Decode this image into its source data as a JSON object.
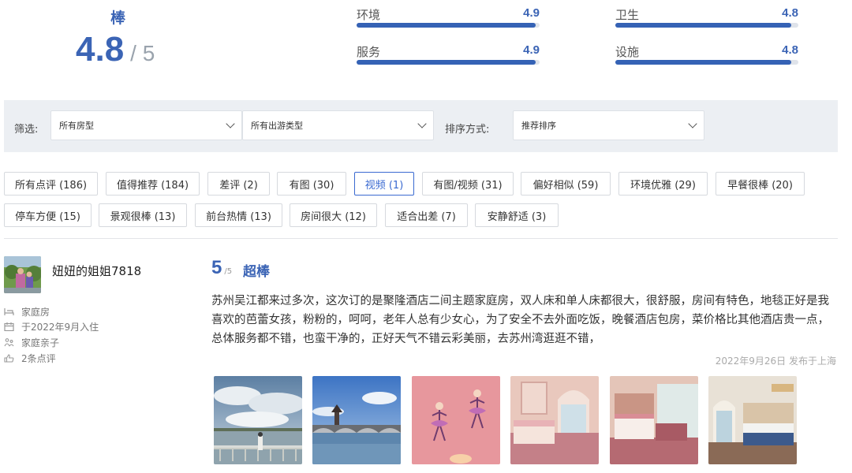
{
  "overall": {
    "word": "棒",
    "score": "4.8",
    "out_of": "/ 5"
  },
  "metrics": [
    {
      "label": "环境",
      "value": "4.9",
      "fraction": 0.98
    },
    {
      "label": "卫生",
      "value": "4.8",
      "fraction": 0.96
    },
    {
      "label": "服务",
      "value": "4.9",
      "fraction": 0.98
    },
    {
      "label": "设施",
      "value": "4.8",
      "fraction": 0.96
    }
  ],
  "filter": {
    "label": "筛选:",
    "room_type": "所有房型",
    "travel_type": "所有出游类型",
    "sort_label": "排序方式:",
    "sort_value": "推荐排序"
  },
  "tags": [
    "所有点评 (186)",
    "值得推荐 (184)",
    "差评 (2)",
    "有图 (30)",
    "视频 (1)",
    "有图/视频 (31)",
    "偏好相似 (59)",
    "环境优雅 (29)",
    "早餐很棒 (20)",
    "停车方便 (15)",
    "景观很棒 (13)",
    "前台热情 (13)",
    "房间很大 (12)",
    "适合出差 (7)",
    "安静舒适 (3)"
  ],
  "active_tag_index": 4,
  "reviewer": {
    "name": "妞妞的姐姐7818",
    "room": "家庭房",
    "checkin": "于2022年9月入住",
    "trip_type": "家庭亲子",
    "review_count": "2条点评"
  },
  "review": {
    "score": "5",
    "out_of": "/5",
    "word": "超棒",
    "text": "苏州吴江都来过多次，这次订的是聚隆酒店二间主题家庭房，双人床和单人床都很大，很舒服，房间有特色，地毯正好是我喜欢的芭蕾女孩，粉粉的，呵呵，老年人总有少女心，为了安全不去外面吃饭，晚餐酒店包房，菜价格比其他酒店贵一点，总体服务都不错，也蛮干净的，正好天气不错云彩美丽，去苏州湾逛逛不错，",
    "meta": "2022年9月26日 发布于上海"
  },
  "colors": {
    "accent": "#3b64b5",
    "bar": "#3562b5",
    "active_tag": "#3a6ad1"
  }
}
